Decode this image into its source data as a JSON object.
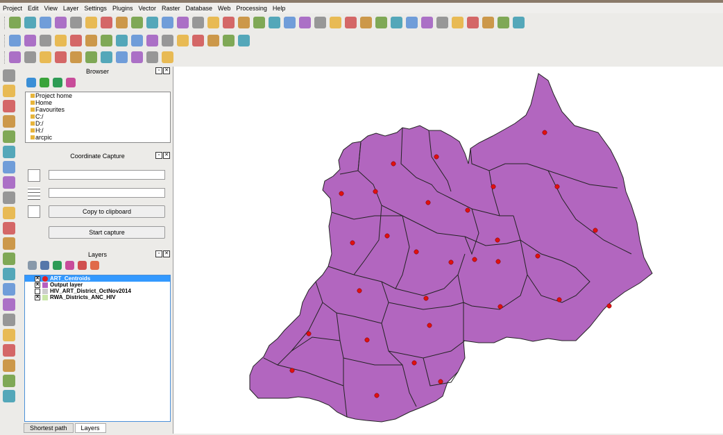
{
  "menu": [
    "Project",
    "Edit",
    "View",
    "Layer",
    "Settings",
    "Plugins",
    "Vector",
    "Raster",
    "Database",
    "Web",
    "Processing",
    "Help"
  ],
  "browser": {
    "title": "Browser",
    "items": [
      "Project home",
      "Home",
      "Favourites",
      "C:/",
      "D:/",
      "H:/",
      "arcpic"
    ]
  },
  "coordinate_capture": {
    "title": "Coordinate Capture",
    "copy_label": "Copy to clipboard",
    "start_label": "Start capture"
  },
  "layers": {
    "title": "Layers",
    "items": [
      {
        "name": "ART_Centroids",
        "color": "#e02020",
        "checked": true,
        "selected": true
      },
      {
        "name": "Output layer",
        "color": "#b55fc1",
        "checked": true,
        "selected": false
      },
      {
        "name": "HIV_ART_District_OctNov2014",
        "color": "#cccccc",
        "checked": false,
        "selected": false
      },
      {
        "name": "RWA_Districts_ANC_HIV",
        "color": "#c9e6a8",
        "checked": true,
        "selected": false
      }
    ]
  },
  "tabs": [
    "Shortest path",
    "Layers"
  ],
  "map": {
    "fill": "#b266bf",
    "point_color": "#e01010"
  }
}
